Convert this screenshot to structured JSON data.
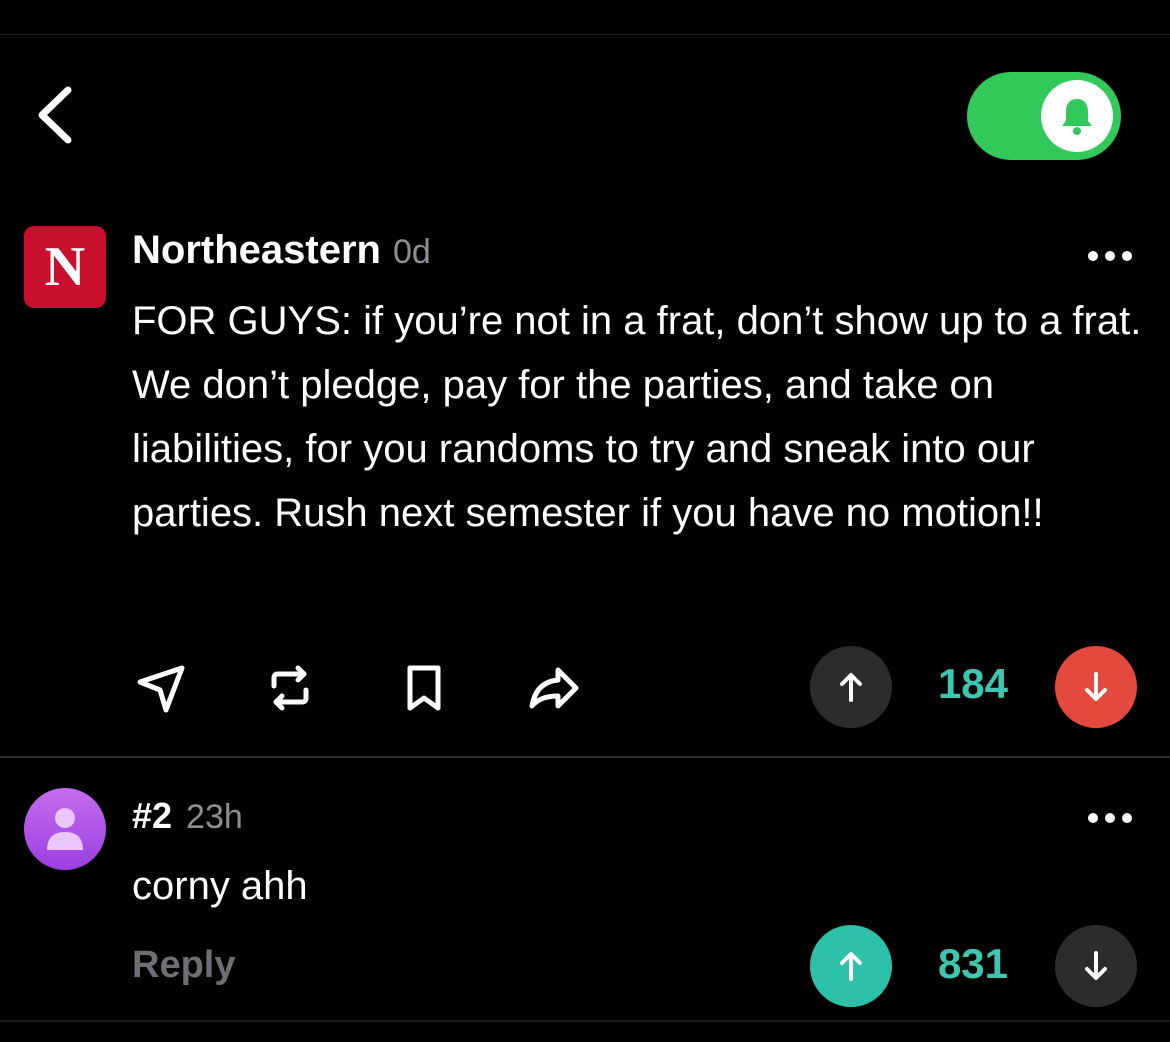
{
  "post": {
    "school_initial": "N",
    "author": "Northeastern",
    "age": "0d",
    "body": "FOR GUYS: if you’re not in a frat, don’t show up to a frat. We don’t pledge, pay for the parties, and take on liabilities, for you randoms to try and sneak into our parties. Rush next semester if you have no motion!!",
    "vote_count": "184",
    "vote_state": "downvoted",
    "actions": [
      "send-icon",
      "repost-icon",
      "bookmark-icon",
      "forward-icon"
    ]
  },
  "notifications": {
    "enabled": true,
    "icon": "bell-icon"
  },
  "comment": {
    "number": "#2",
    "age": "23h",
    "body": "corny ahh",
    "reply_label": "Reply",
    "vote_count": "831",
    "vote_state": "upvoted"
  },
  "colors": {
    "accent_green": "#32c85a",
    "teal": "#3ec7b0",
    "downvote_red": "#e4493e",
    "school_red": "#c8102e",
    "avatar_purple": "#b357ea"
  }
}
